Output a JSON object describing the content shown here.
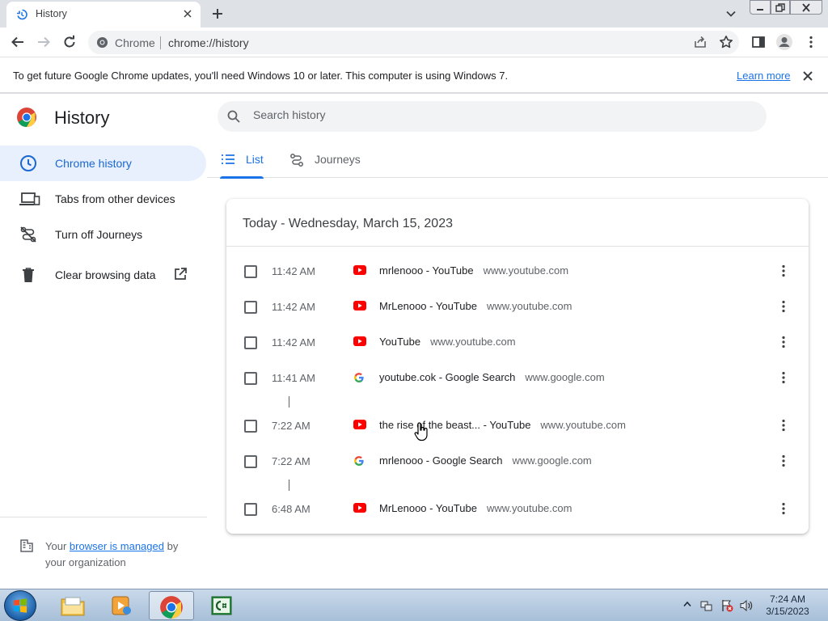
{
  "browser": {
    "tab_title": "History",
    "omnibox_label": "Chrome",
    "url": "chrome://history"
  },
  "infobar": {
    "message": "To get future Google Chrome updates, you'll need Windows 10 or later. This computer is using Windows 7.",
    "learn_more": "Learn more"
  },
  "page": {
    "title": "History",
    "search_placeholder": "Search history"
  },
  "sidebar": {
    "items": [
      {
        "label": "Chrome history",
        "icon": "clock-icon",
        "active": true
      },
      {
        "label": "Tabs from other devices",
        "icon": "devices-icon"
      },
      {
        "label": "Turn off Journeys",
        "icon": "journeys-off-icon"
      },
      {
        "label": "Clear browsing data",
        "icon": "trash-icon"
      }
    ],
    "managed_prefix": "Your",
    "managed_link": "browser is managed",
    "managed_suffix": "by your organization"
  },
  "tabs": [
    {
      "label": "List",
      "icon": "list-icon",
      "active": true
    },
    {
      "label": "Journeys",
      "icon": "journeys-icon"
    }
  ],
  "history": {
    "date_header": "Today - Wednesday, March 15, 2023",
    "rows": [
      {
        "time": "11:42 AM",
        "title": "mrlenooo - YouTube",
        "domain": "www.youtube.com",
        "icon": "youtube-icon"
      },
      {
        "time": "11:42 AM",
        "title": "MrLenooo - YouTube",
        "domain": "www.youtube.com",
        "icon": "youtube-icon"
      },
      {
        "time": "11:42 AM",
        "title": "YouTube",
        "domain": "www.youtube.com",
        "icon": "youtube-icon"
      },
      {
        "time": "11:41 AM",
        "title": "youtube.cok - Google Search",
        "domain": "www.google.com",
        "icon": "google-icon"
      },
      {
        "time": "7:22 AM",
        "title": "the rise of the beast... - YouTube",
        "domain": "www.youtube.com",
        "icon": "youtube-icon"
      },
      {
        "time": "7:22 AM",
        "title": "mrlenooo - Google Search",
        "domain": "www.google.com",
        "icon": "google-icon"
      },
      {
        "time": "6:48 AM",
        "title": "MrLenooo - YouTube",
        "domain": "www.youtube.com",
        "icon": "youtube-icon"
      }
    ]
  },
  "taskbar": {
    "time": "7:24 AM",
    "date": "3/15/2023"
  },
  "colors": {
    "accent": "#1a73e8",
    "active_bg": "#e8f0fe",
    "youtube_red": "#ff0000"
  }
}
